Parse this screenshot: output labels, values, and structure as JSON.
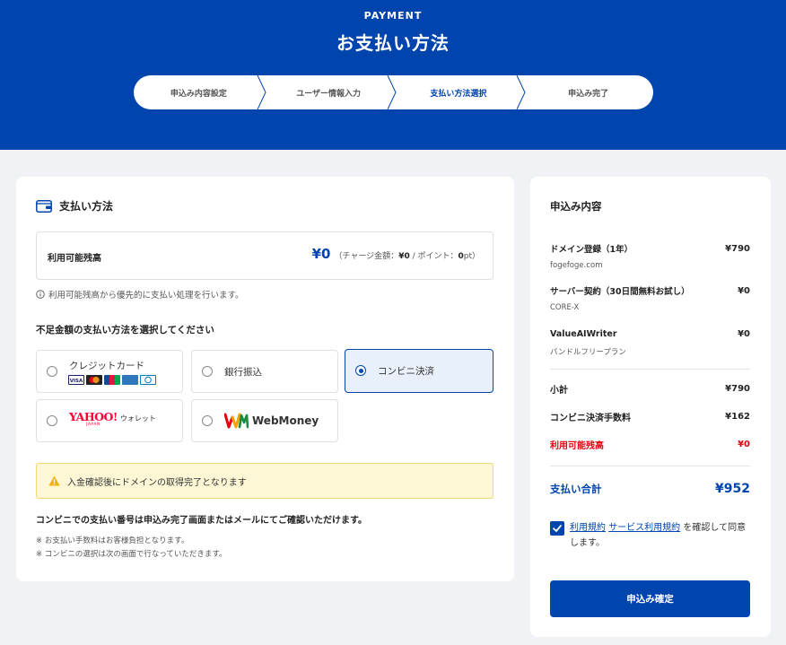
{
  "header": {
    "eyebrow": "PAYMENT",
    "title": "お支払い方法",
    "steps": [
      {
        "label": "申込み内容設定",
        "active": false
      },
      {
        "label": "ユーザー情報入力",
        "active": false
      },
      {
        "label": "支払い方法選択",
        "active": true
      },
      {
        "label": "申込み完了",
        "active": false
      }
    ]
  },
  "payment": {
    "section_title": "支払い方法",
    "balance": {
      "label": "利用可能残高",
      "amount": "¥0",
      "detail_prefix": "（チャージ金額：",
      "charge": "¥0",
      "detail_mid": " / ポイント：",
      "points": "0",
      "points_unit": "pt）"
    },
    "balance_note": "利用可能残高から優先的に支払い処理を行います。",
    "methods_heading": "不足金額の支払い方法を選択してください",
    "methods": [
      {
        "label": "クレジットカード",
        "selected": false
      },
      {
        "label": "銀行振込",
        "selected": false
      },
      {
        "label": "コンビニ決済",
        "selected": true
      },
      {
        "label": "YAHOO!",
        "sub": "JAPAN",
        "suffix": "ウォレット",
        "selected": false
      },
      {
        "label": "WebMoney",
        "selected": false
      }
    ],
    "card_brands": [
      "visa",
      "mastercard",
      "jcb",
      "amex",
      "diners"
    ],
    "warning": "入金確認後にドメインの取得完了となります",
    "convenience_note": "コンビニでの支払い番号は申込み完了画面またはメールにてご確認いただけます。",
    "notes": [
      "※ お支払い手数料はお客様負担となります。",
      "※ コンビニの選択は次の画面で行なっていただきます。"
    ]
  },
  "summary": {
    "title": "申込み内容",
    "items": [
      {
        "name": "ドメイン登録（1年）",
        "sub": "fogefoge.com",
        "price": "¥790"
      },
      {
        "name": "サーバー契約（30日間無料お試し）",
        "sub": "CORE-X",
        "price": "¥0"
      },
      {
        "name": "ValueAIWriter",
        "sub": "バンドルフリープラン",
        "price": "¥0"
      }
    ],
    "subtotal_label": "小計",
    "subtotal": "¥790",
    "fee_label": "コンビニ決済手数料",
    "fee": "¥162",
    "balance_label": "利用可能残高",
    "balance": "¥0",
    "total_label": "支払い合計",
    "total": "¥952",
    "agree_link1": "利用規約",
    "agree_link2": "サービス利用規約",
    "agree_text": "を確認して同意します。",
    "agree_checked": true,
    "confirm_label": "申込み確定"
  },
  "colors": {
    "brand": "#0044ad",
    "danger": "#e4000f",
    "warning_bg": "#fdf7d6"
  }
}
